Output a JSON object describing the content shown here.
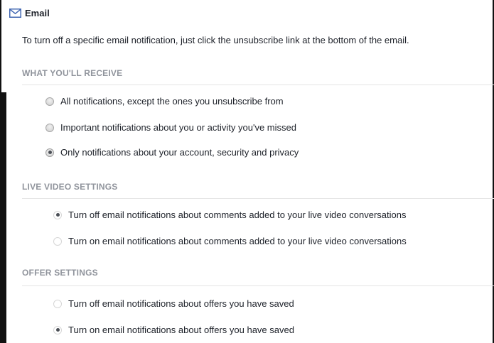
{
  "header": {
    "icon": "mail-icon",
    "title": "Email"
  },
  "intro_text": "To turn off a specific email notification, just click the unsubscribe link at the bottom of the email.",
  "sections": [
    {
      "title": "WHAT YOU'LL RECEIVE",
      "options": [
        {
          "label": "All notifications, except the ones you unsubscribe from",
          "selected": false
        },
        {
          "label": "Important notifications about you or activity you've missed",
          "selected": false
        },
        {
          "label": "Only notifications about your account, security and privacy",
          "selected": true
        }
      ]
    },
    {
      "title": "LIVE VIDEO SETTINGS",
      "options": [
        {
          "label": "Turn off email notifications about comments added to your live video conversations",
          "selected": true
        },
        {
          "label": "Turn on email notifications about comments added to your live video conversations",
          "selected": false
        }
      ]
    },
    {
      "title": "OFFER SETTINGS",
      "options": [
        {
          "label": "Turn off email notifications about offers you have saved",
          "selected": false
        },
        {
          "label": "Turn on email notifications about offers you have saved",
          "selected": true
        }
      ]
    }
  ]
}
